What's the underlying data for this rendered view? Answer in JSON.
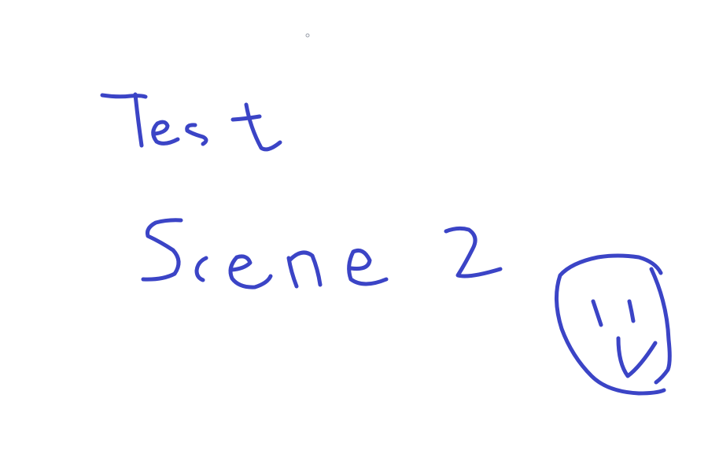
{
  "canvas": {
    "background": "#ffffff",
    "ink_color": "#3b44c6",
    "cursor_color": "#9aa0aa",
    "handwritten_text": [
      "Test",
      "Scene 2"
    ],
    "doodle": "smiley-face"
  }
}
